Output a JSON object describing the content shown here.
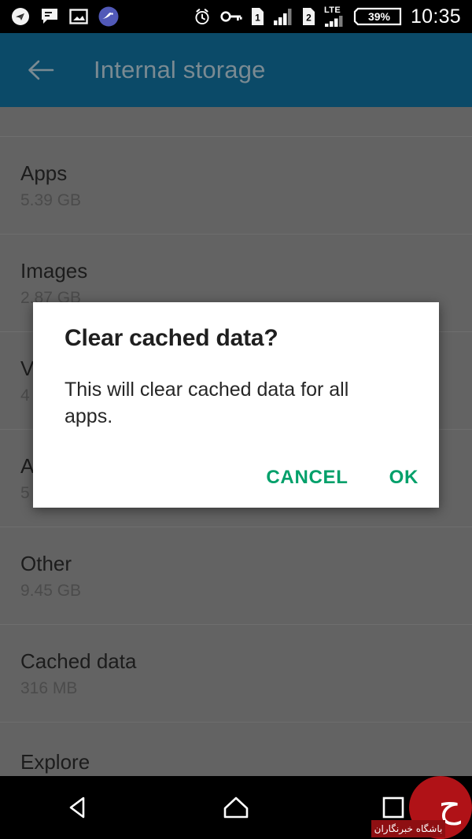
{
  "status_bar": {
    "left_icons": [
      {
        "name": "telegram-icon",
        "glyph": "➤"
      },
      {
        "name": "sms-message-icon",
        "glyph": "✉"
      },
      {
        "name": "screenshot-image-icon",
        "glyph": "⛰"
      },
      {
        "name": "app-notification-icon",
        "glyph": "✎"
      }
    ],
    "right_icons": [
      {
        "name": "alarm-clock-icon"
      },
      {
        "name": "vpn-key-icon"
      },
      {
        "name": "sim-1-icon",
        "label": "1"
      },
      {
        "name": "signal-bars-sim1-icon"
      },
      {
        "name": "sim-2-icon",
        "label": "2"
      },
      {
        "name": "lte-label",
        "label": "LTE"
      },
      {
        "name": "signal-bars-sim2-icon"
      }
    ],
    "battery_percent": "39%",
    "clock": "10:35"
  },
  "app_bar": {
    "back_label": "back",
    "title": "Internal storage",
    "background_color": "#0b4a68",
    "title_color": "#7a8a92"
  },
  "storage_list": [
    {
      "name": "list-item-partial-top",
      "title": "",
      "size": "",
      "partial": true
    },
    {
      "name": "list-item-apps",
      "title": "Apps",
      "size": "5.39 GB"
    },
    {
      "name": "list-item-images",
      "title": "Images",
      "size": "2.87 GB"
    },
    {
      "name": "list-item-videos",
      "title": "V",
      "size": "4"
    },
    {
      "name": "list-item-audio",
      "title": "A",
      "size": "5"
    },
    {
      "name": "list-item-other",
      "title": "Other",
      "size": "9.45 GB"
    },
    {
      "name": "list-item-cached-data",
      "title": "Cached data",
      "size": "316 MB"
    },
    {
      "name": "list-item-explore",
      "title": "Explore",
      "size": ""
    }
  ],
  "dialog": {
    "title": "Clear cached data?",
    "message": "This will clear cached data for all apps.",
    "cancel_label": "CANCEL",
    "ok_label": "OK",
    "accent_color": "#00a06a"
  },
  "nav_bar": {
    "back_label": "back",
    "home_label": "home",
    "recents_label": "recents"
  },
  "watermark": {
    "text": "باشگاه خبرنگاران",
    "glyph": "ح",
    "circle_color": "#b01217",
    "bar_color": "#8e0f12"
  }
}
